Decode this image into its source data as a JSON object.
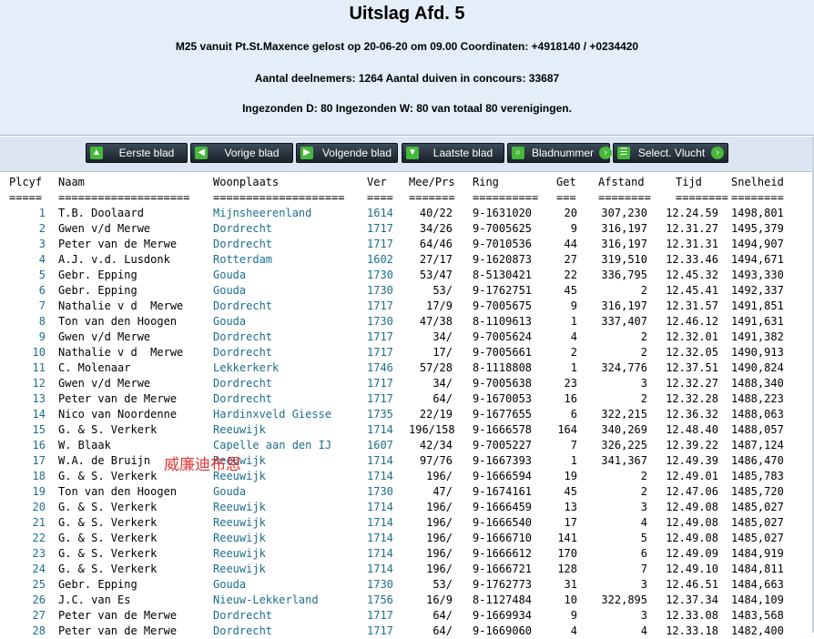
{
  "header": {
    "title": "Uitslag Afd. 5",
    "line1": "M25 vanuit Pt.St.Maxence gelost op 20-06-20 om 09.00 Coordinaten: +4918140 / +0234420",
    "line2": "Aantal deelnemers: 1264 Aantal duiven in concours: 33687",
    "line3": "Ingezonden D: 80 Ingezonden W: 80 van totaal 80 verenigingen."
  },
  "nav": {
    "first": "Eerste blad",
    "prev": "Vorige blad",
    "next": "Volgende blad",
    "last": "Laatste blad",
    "pagenum": "Bladnummer",
    "select": "Select. Vlucht"
  },
  "icons": {
    "first": "arrow-up-icon",
    "prev": "arrow-left-icon",
    "next": "arrow-right-icon",
    "last": "arrow-down-icon",
    "pagenum": "search-icon",
    "select": "list-icon",
    "accent": "#46b83a"
  },
  "columns": {
    "plcyf": "Plcyf",
    "naam": "Naam",
    "woonplaats": "Woonplaats",
    "ver": "Ver",
    "mee": "Mee/Prs",
    "ring": "Ring",
    "get": "Get",
    "afstand": "Afstand",
    "tijd": "Tijd",
    "snelheid": "Snelheid"
  },
  "separators": {
    "plcyf": "=====",
    "naam": "====================",
    "woonplaats": "====================",
    "ver": "====",
    "mee": "=======",
    "ring": "==========",
    "get": "===",
    "afstand": "========",
    "tijd": "========",
    "snelheid": "========"
  },
  "rows": [
    {
      "pl": "1",
      "naam": "T.B. Doolaard",
      "woon": "Mijnsheerenland",
      "ver": "1614",
      "mee": "40/22",
      "ring": "9-1631020",
      "get": "20",
      "afs": "307,230",
      "tijd": "12.24.59",
      "snel": "1498,801"
    },
    {
      "pl": "2",
      "naam": "Gwen v/d Merwe",
      "woon": "Dordrecht",
      "ver": "1717",
      "mee": "34/26",
      "ring": "9-7005625",
      "get": "9",
      "afs": "316,197",
      "tijd": "12.31.27",
      "snel": "1495,379"
    },
    {
      "pl": "3",
      "naam": "Peter van de Merwe",
      "woon": "Dordrecht",
      "ver": "1717",
      "mee": "64/46",
      "ring": "9-7010536",
      "get": "44",
      "afs": "316,197",
      "tijd": "12.31.31",
      "snel": "1494,907"
    },
    {
      "pl": "4",
      "naam": "A.J. v.d. Lusdonk",
      "woon": "Rotterdam",
      "ver": "1602",
      "mee": "27/17",
      "ring": "9-1620873",
      "get": "27",
      "afs": "319,510",
      "tijd": "12.33.46",
      "snel": "1494,671"
    },
    {
      "pl": "5",
      "naam": "Gebr. Epping",
      "woon": "Gouda",
      "ver": "1730",
      "mee": "53/47",
      "ring": "8-5130421",
      "get": "22",
      "afs": "336,795",
      "tijd": "12.45.32",
      "snel": "1493,330"
    },
    {
      "pl": "6",
      "naam": "Gebr. Epping",
      "woon": "Gouda",
      "ver": "1730",
      "mee": "53/",
      "ring": "9-1762751",
      "get": "45",
      "afs": "2",
      "tijd": "12.45.41",
      "snel": "1492,337"
    },
    {
      "pl": "7",
      "naam": "Nathalie v d  Merwe",
      "woon": "Dordrecht",
      "ver": "1717",
      "mee": "17/9",
      "ring": "9-7005675",
      "get": "9",
      "afs": "316,197",
      "tijd": "12.31.57",
      "snel": "1491,851"
    },
    {
      "pl": "8",
      "naam": "Ton van den Hoogen",
      "woon": "Gouda",
      "ver": "1730",
      "mee": "47/38",
      "ring": "8-1109613",
      "get": "1",
      "afs": "337,407",
      "tijd": "12.46.12",
      "snel": "1491,631"
    },
    {
      "pl": "9",
      "naam": "Gwen v/d Merwe",
      "woon": "Dordrecht",
      "ver": "1717",
      "mee": "34/",
      "ring": "9-7005624",
      "get": "4",
      "afs": "2",
      "tijd": "12.32.01",
      "snel": "1491,382"
    },
    {
      "pl": "10",
      "naam": "Nathalie v d  Merwe",
      "woon": "Dordrecht",
      "ver": "1717",
      "mee": "17/",
      "ring": "9-7005661",
      "get": "2",
      "afs": "2",
      "tijd": "12.32.05",
      "snel": "1490,913"
    },
    {
      "pl": "11",
      "naam": "C. Molenaar",
      "woon": "Lekkerkerk",
      "ver": "1746",
      "mee": "57/28",
      "ring": "8-1118808",
      "get": "1",
      "afs": "324,776",
      "tijd": "12.37.51",
      "snel": "1490,824"
    },
    {
      "pl": "12",
      "naam": "Gwen v/d Merwe",
      "woon": "Dordrecht",
      "ver": "1717",
      "mee": "34/",
      "ring": "9-7005638",
      "get": "23",
      "afs": "3",
      "tijd": "12.32.27",
      "snel": "1488,340"
    },
    {
      "pl": "13",
      "naam": "Peter van de Merwe",
      "woon": "Dordrecht",
      "ver": "1717",
      "mee": "64/",
      "ring": "9-1670053",
      "get": "16",
      "afs": "2",
      "tijd": "12.32.28",
      "snel": "1488,223"
    },
    {
      "pl": "14",
      "naam": "Nico van Noordenne",
      "woon": "Hardinxveld Giesse",
      "ver": "1735",
      "mee": "22/19",
      "ring": "9-1677655",
      "get": "6",
      "afs": "322,215",
      "tijd": "12.36.32",
      "snel": "1488,063"
    },
    {
      "pl": "15",
      "naam": "G. & S. Verkerk",
      "woon": "Reeuwijk",
      "ver": "1714",
      "mee": "196/158",
      "ring": "9-1666578",
      "get": "164",
      "afs": "340,269",
      "tijd": "12.48.40",
      "snel": "1488,057"
    },
    {
      "pl": "16",
      "naam": "W. Blaak",
      "woon": "Capelle aan den IJ",
      "ver": "1607",
      "mee": "42/34",
      "ring": "9-7005227",
      "get": "7",
      "afs": "326,225",
      "tijd": "12.39.22",
      "snel": "1487,124"
    },
    {
      "pl": "17",
      "naam": "W.A. de Bruijn",
      "woon": "Reeuwijk",
      "ver": "1714",
      "mee": "97/76",
      "ring": "9-1667393",
      "get": "1",
      "afs": "341,367",
      "tijd": "12.49.39",
      "snel": "1486,470"
    },
    {
      "pl": "18",
      "naam": "G. & S. Verkerk",
      "woon": "Reeuwijk",
      "ver": "1714",
      "mee": "196/",
      "ring": "9-1666594",
      "get": "19",
      "afs": "2",
      "tijd": "12.49.01",
      "snel": "1485,783"
    },
    {
      "pl": "19",
      "naam": "Ton van den Hoogen",
      "woon": "Gouda",
      "ver": "1730",
      "mee": "47/",
      "ring": "9-1674161",
      "get": "45",
      "afs": "2",
      "tijd": "12.47.06",
      "snel": "1485,720"
    },
    {
      "pl": "20",
      "naam": "G. & S. Verkerk",
      "woon": "Reeuwijk",
      "ver": "1714",
      "mee": "196/",
      "ring": "9-1666459",
      "get": "13",
      "afs": "3",
      "tijd": "12.49.08",
      "snel": "1485,027"
    },
    {
      "pl": "21",
      "naam": "G. & S. Verkerk",
      "woon": "Reeuwijk",
      "ver": "1714",
      "mee": "196/",
      "ring": "9-1666540",
      "get": "17",
      "afs": "4",
      "tijd": "12.49.08",
      "snel": "1485,027"
    },
    {
      "pl": "22",
      "naam": "G. & S. Verkerk",
      "woon": "Reeuwijk",
      "ver": "1714",
      "mee": "196/",
      "ring": "9-1666710",
      "get": "141",
      "afs": "5",
      "tijd": "12.49.08",
      "snel": "1485,027"
    },
    {
      "pl": "23",
      "naam": "G. & S. Verkerk",
      "woon": "Reeuwijk",
      "ver": "1714",
      "mee": "196/",
      "ring": "9-1666612",
      "get": "170",
      "afs": "6",
      "tijd": "12.49.09",
      "snel": "1484,919"
    },
    {
      "pl": "24",
      "naam": "G. & S. Verkerk",
      "woon": "Reeuwijk",
      "ver": "1714",
      "mee": "196/",
      "ring": "9-1666721",
      "get": "128",
      "afs": "7",
      "tijd": "12.49.10",
      "snel": "1484,811"
    },
    {
      "pl": "25",
      "naam": "Gebr. Epping",
      "woon": "Gouda",
      "ver": "1730",
      "mee": "53/",
      "ring": "9-1762773",
      "get": "31",
      "afs": "3",
      "tijd": "12.46.51",
      "snel": "1484,663"
    },
    {
      "pl": "26",
      "naam": "J.C. van Es",
      "woon": "Nieuw-Lekkerland",
      "ver": "1756",
      "mee": "16/9",
      "ring": "8-1127484",
      "get": "10",
      "afs": "322,895",
      "tijd": "12.37.34",
      "snel": "1484,109"
    },
    {
      "pl": "27",
      "naam": "Peter van de Merwe",
      "woon": "Dordrecht",
      "ver": "1717",
      "mee": "64/",
      "ring": "9-1669934",
      "get": "9",
      "afs": "3",
      "tijd": "12.33.08",
      "snel": "1483,568"
    },
    {
      "pl": "28",
      "naam": "Peter van de Merwe",
      "woon": "Dordrecht",
      "ver": "1717",
      "mee": "64/",
      "ring": "9-1669060",
      "get": "4",
      "afs": "4",
      "tijd": "12.33.18",
      "snel": "1482,400"
    }
  ],
  "watermark": "威廉迪布恩"
}
